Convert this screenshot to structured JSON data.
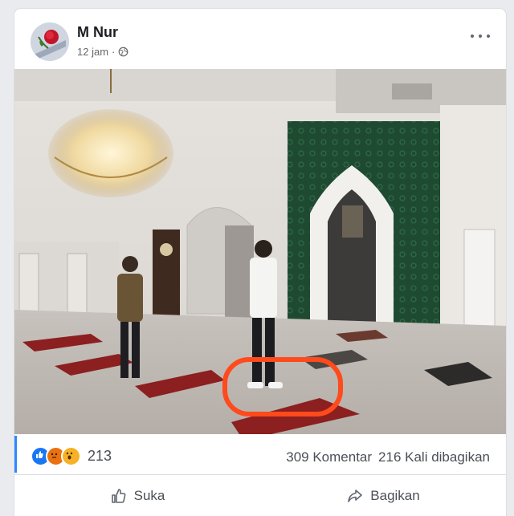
{
  "post": {
    "author": "M Nur",
    "timestamp": "12 jam",
    "separator": "·",
    "privacy_icon": "globe-icon",
    "reactions_count": "213",
    "reaction_icons": [
      "like-icon",
      "angry-icon",
      "wow-icon"
    ],
    "comments": "309 Komentar",
    "shares": "216 Kali dibagikan"
  },
  "actions": {
    "like_label": "Suka",
    "share_label": "Bagikan"
  },
  "colors": {
    "accent": "#2d88ff",
    "highlight_circle": "#ff4a1c",
    "text_secondary": "#65676b"
  }
}
